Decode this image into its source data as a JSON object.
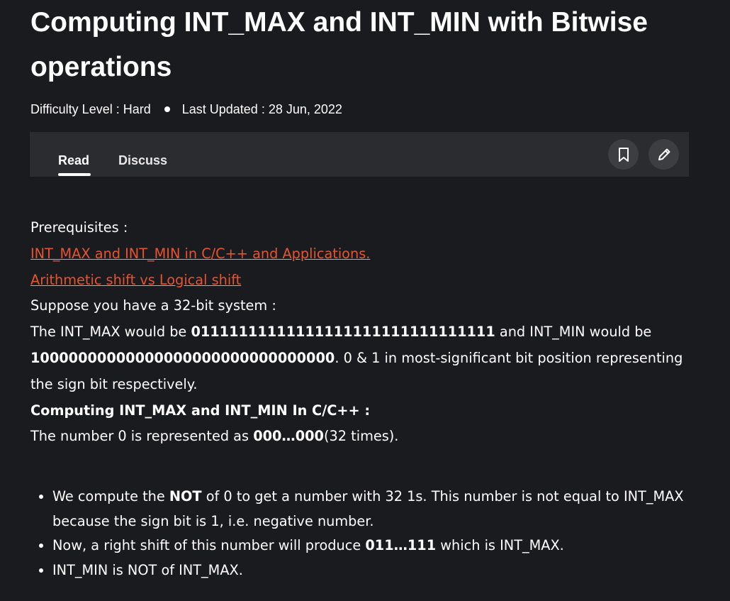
{
  "article": {
    "title": "Computing INT_MAX and INT_MIN with Bitwise operations",
    "difficulty": "Difficulty Level : Hard",
    "updated": "Last Updated : 28 Jun, 2022"
  },
  "tabs": {
    "read": "Read",
    "discuss": "Discuss"
  },
  "icons": {
    "bookmark": "bookmark-icon",
    "edit": "pencil-icon"
  },
  "body": {
    "prereq_label": "Prerequisites :",
    "link1": "INT_MAX and INT_MIN in C/C++ and Applications.",
    "link2": "Arithmetic shift vs Logical shift",
    "suppose": "Suppose you have a 32-bit system :",
    "p1_a": "The INT_MAX would be ",
    "p1_max": "01111111111111111111111111111111",
    "p1_b": " and INT_MIN would be ",
    "p1_min": "10000000000000000000000000000000",
    "p1_c": ". 0 & 1 in most-significant bit position representing the sign bit respectively.",
    "heading": "Computing INT_MAX and INT_MIN In C/C++ :",
    "p2_a": "The number 0 is represented as ",
    "p2_b": "000…000",
    "p2_c": "(32 times).",
    "b1_a": "We compute the ",
    "b1_b": "NOT",
    "b1_c": " of 0 to get a number with 32 1s. This number is not equal to INT_MAX because the sign bit is 1, i.e. negative number.",
    "b2_a": "Now, a right shift of this number will produce ",
    "b2_b": "011…111",
    "b2_c": " which is INT_MAX.",
    "b3": "INT_MIN is NOT of INT_MAX."
  },
  "colors": {
    "background": "#1a1b1f",
    "tabbar": "#2b2c30",
    "link": "#e8532f"
  }
}
